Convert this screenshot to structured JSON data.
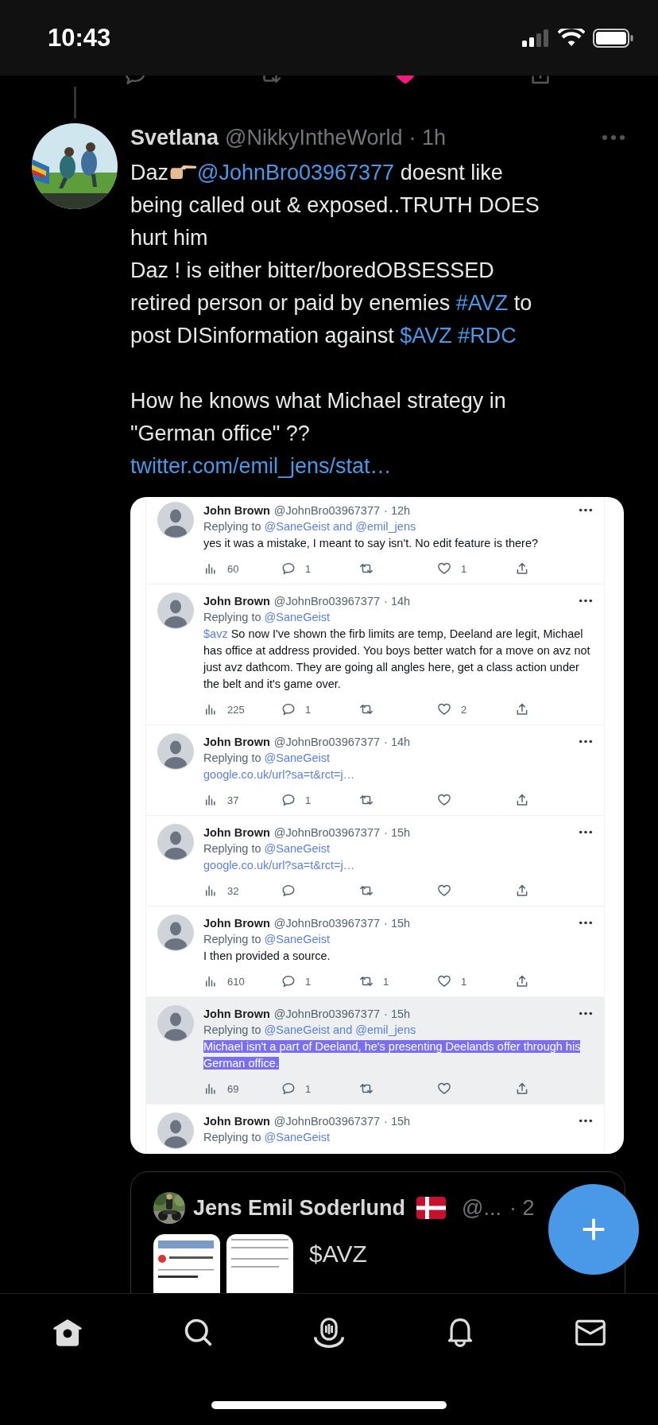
{
  "status_bar": {
    "time": "10:43"
  },
  "previous_tweet_actions": {
    "liked": true
  },
  "tweet": {
    "name": "Svetlana",
    "handle": "@NikkyIntheWorld",
    "time": "· 1h",
    "text": [
      {
        "kind": "text",
        "text": "Daz"
      },
      {
        "kind": "emoji"
      },
      {
        "kind": "mention",
        "text": "@JohnBro03967377"
      },
      {
        "kind": "text",
        "text": " doesnt like\nbeing called out & exposed..TRUTH DOES\nhurt him\nDaz ! is either bitter/boredOBSESSED\nretired person or paid by enemies "
      },
      {
        "kind": "hashtag",
        "text": "#AVZ"
      },
      {
        "kind": "text",
        "text": " to\npost DISinformation against "
      },
      {
        "kind": "cashtag",
        "text": "$AVZ"
      },
      {
        "kind": "hashtag",
        "text": "#RDC"
      },
      {
        "kind": "text",
        "text": "\n\nHow he knows what Michael strategy in\n\"German office\" ??\n"
      },
      {
        "kind": "link",
        "text": "twitter.com/emil_jens/stat…"
      }
    ]
  },
  "embedded_screenshot": {
    "replies": [
      {
        "name": "John Brown",
        "handle": "@JohnBro03967377",
        "time": "· 12h",
        "replying_label": "Replying to",
        "replying_handles": "@SaneGeist and @emil_jens",
        "selected": false,
        "body": [
          {
            "kind": "text",
            "text": "yes it was a mistake, I meant to say isn't. No edit feature is there?"
          }
        ],
        "stats": {
          "views": "60",
          "replies": "1",
          "likes": "1"
        }
      },
      {
        "name": "John Brown",
        "handle": "@JohnBro03967377",
        "time": "· 14h",
        "replying_label": "Replying to",
        "replying_handles": "@SaneGeist",
        "selected": false,
        "body": [
          {
            "kind": "cashtag",
            "text": "$avz"
          },
          {
            "kind": "text",
            "text": " So now I've shown the firb limits are temp, Deeland are legit, Michael has office at address provided. You boys better watch for a move on avz not just avz dathcom. They are going all angles here, get a class action under the belt and it's game over."
          }
        ],
        "stats": {
          "views": "225",
          "replies": "1",
          "likes": "2"
        }
      },
      {
        "name": "John Brown",
        "handle": "@JohnBro03967377",
        "time": "· 14h",
        "replying_label": "Replying to",
        "replying_handles": "@SaneGeist",
        "selected": false,
        "body": [
          {
            "kind": "link",
            "text": "google.co.uk/url?sa=t&rct=j…"
          }
        ],
        "stats": {
          "views": "37",
          "replies": "1"
        }
      },
      {
        "name": "John Brown",
        "handle": "@JohnBro03967377",
        "time": "· 15h",
        "replying_label": "Replying to",
        "replying_handles": "@SaneGeist",
        "selected": false,
        "body": [
          {
            "kind": "link",
            "text": "google.co.uk/url?sa=t&rct=j…"
          }
        ],
        "stats": {
          "views": "32"
        }
      },
      {
        "name": "John Brown",
        "handle": "@JohnBro03967377",
        "time": "· 15h",
        "replying_label": "Replying to",
        "replying_handles": "@SaneGeist",
        "selected": false,
        "body": [
          {
            "kind": "text",
            "text": "I then provided a source."
          }
        ],
        "stats": {
          "views": "610",
          "replies": "1",
          "retweets": "1",
          "likes": "1"
        }
      },
      {
        "name": "John Brown",
        "handle": "@JohnBro03967377",
        "time": "· 15h",
        "replying_label": "Replying to",
        "replying_handles": "@SaneGeist and @emil_jens",
        "selected": true,
        "body": [
          {
            "kind": "text",
            "text": "Michael isn't a part of Deeland, he's presenting Deelands offer through his German office."
          }
        ],
        "stats": {
          "views": "69",
          "replies": "1"
        }
      },
      {
        "name": "John Brown",
        "handle": "@JohnBro03967377",
        "time": "· 15h",
        "replying_label": "Replying to",
        "replying_handles": "@SaneGeist",
        "selected": false
      }
    ]
  },
  "quoted_tweet": {
    "name": "Jens Emil Soderlund",
    "handle": "@...",
    "time": "· 2",
    "text": "$AVZ"
  },
  "tab_bar": {
    "tabs": [
      {
        "kind": "home",
        "selected": true
      },
      {
        "kind": "search",
        "selected": false
      },
      {
        "kind": "spaces",
        "selected": false
      },
      {
        "kind": "notifications",
        "selected": false
      },
      {
        "kind": "messages",
        "selected": false
      }
    ]
  }
}
